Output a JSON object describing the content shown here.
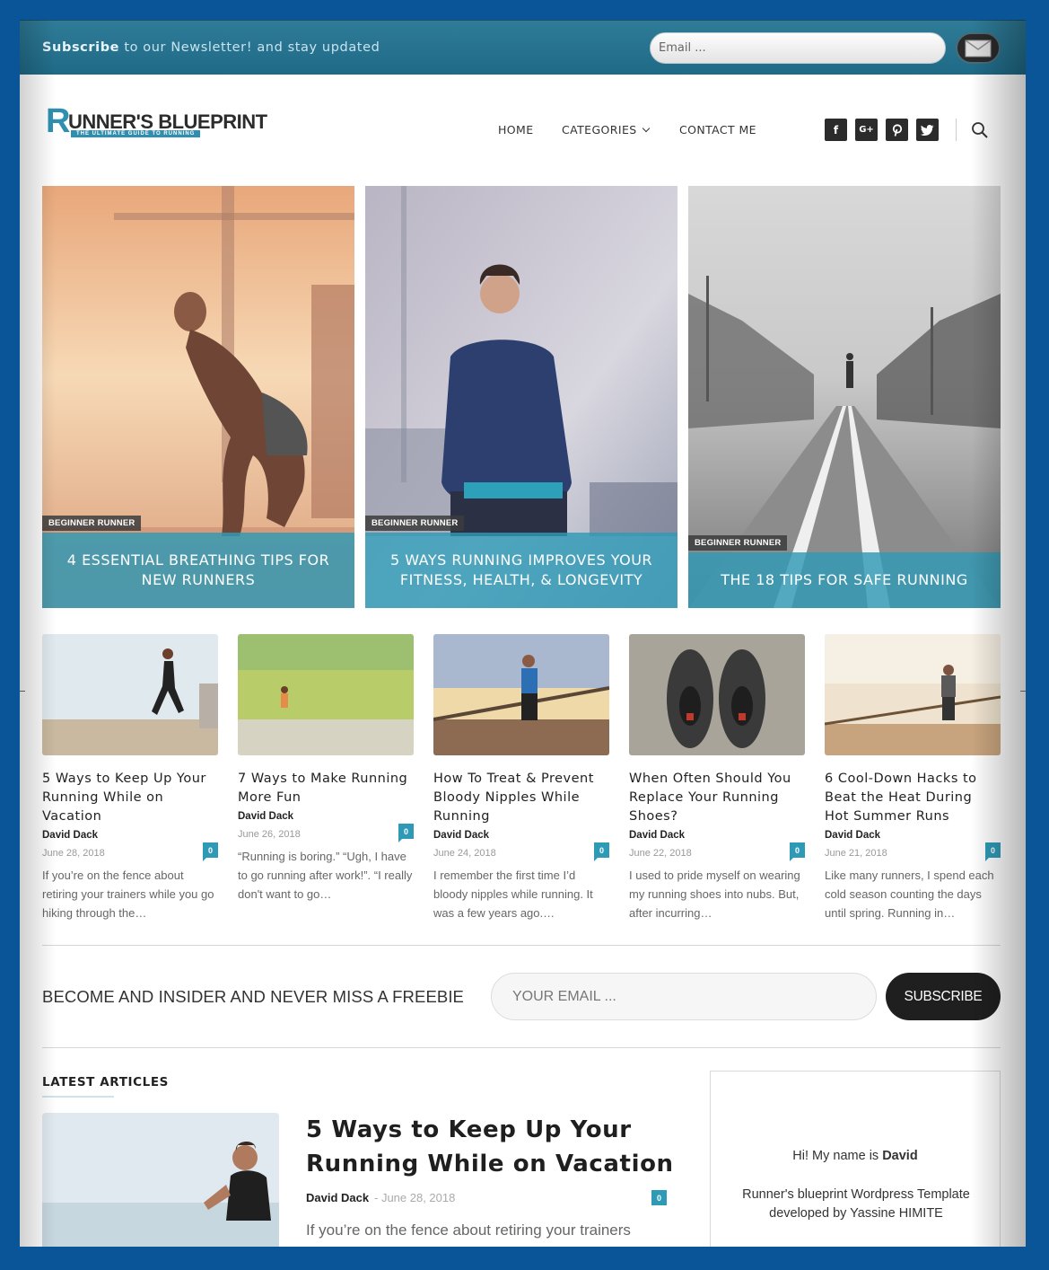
{
  "newsletter_bar": {
    "bold": "Subscribe",
    "text": " to our Newsletter! and stay updated",
    "email_placeholder": "Email ...",
    "submit_icon": "envelope-icon"
  },
  "header": {
    "logo_main": "UNNER'S BLUEPRINT",
    "logo_initial": "R",
    "logo_tagline": "THE ULTIMATE GUIDE TO RUNNING",
    "nav": [
      "HOME",
      "CATEGORIES",
      "CONTACT ME"
    ],
    "social": [
      {
        "icon": "facebook-icon",
        "glyph": "f"
      },
      {
        "icon": "google-plus-icon",
        "glyph": "G+"
      },
      {
        "icon": "pinterest-icon",
        "glyph": "p"
      },
      {
        "icon": "twitter-icon",
        "glyph": "t"
      }
    ],
    "search_icon": "search-icon"
  },
  "featured": [
    {
      "tag": "BEGINNER RUNNER",
      "title": "4 ESSENTIAL BREATHING TIPS FOR NEW RUNNERS"
    },
    {
      "tag": "BEGINNER RUNNER",
      "title": "5 WAYS RUNNING IMPROVES YOUR FITNESS, HEALTH, & LONGEVITY"
    },
    {
      "tag": "BEGINNER RUNNER",
      "title": "THE 18 TIPS FOR SAFE RUNNING"
    }
  ],
  "posts": [
    {
      "title": "5 Ways to Keep Up Your Running While on Vacation",
      "author": "David Dack",
      "date": "June 28, 2018",
      "comments": "0",
      "excerpt": "If you’re on the fence about retiring your trainers while you go hiking through the…"
    },
    {
      "title": "7 Ways to Make Running More Fun",
      "author": "David Dack",
      "date": "June 26, 2018",
      "comments": "0",
      "excerpt": "“Running is boring.” “Ugh, I have to go running after work!”. “I really don't want to go…"
    },
    {
      "title": "How To Treat & Prevent Bloody Nipples While Running",
      "author": "David Dack",
      "date": "June 24, 2018",
      "comments": "0",
      "excerpt": "I remember the first time I’d bloody nipples while running. It was a few years ago.…"
    },
    {
      "title": "When Often Should You Replace Your Running Shoes?",
      "author": "David Dack",
      "date": "June 22, 2018",
      "comments": "0",
      "excerpt": "I used to pride myself on wearing my running shoes into nubs. But, after incurring…"
    },
    {
      "title": "6 Cool-Down Hacks to Beat the Heat During Hot Summer Runs",
      "author": "David Dack",
      "date": "June 21, 2018",
      "comments": "0",
      "excerpt": "Like many runners, I spend each cold season counting the days until spring. Running in…"
    }
  ],
  "subscribe": {
    "text": "BECOME AND INSIDER AND NEVER MISS A FREEBIE",
    "placeholder": "YOUR EMAIL ...",
    "button": "SUBSCRIBE"
  },
  "latest": {
    "heading": "LATEST ARTICLES",
    "title": "5 Ways to Keep Up Your Running While on Vacation",
    "author": "David Dack",
    "date": "- June 28, 2018",
    "comments": "0",
    "excerpt": "If you’re on the fence about retiring your trainers"
  },
  "about": {
    "hi_prefix": "Hi! My name is ",
    "name": "David",
    "description": "Runner's blueprint Wordpress Template developed by Yassine HIMITE"
  },
  "colors": {
    "accent": "#2f9ab6",
    "topbar": "#1f6a87",
    "page_bg": "#0a5597",
    "dark": "#1f1f1f"
  }
}
